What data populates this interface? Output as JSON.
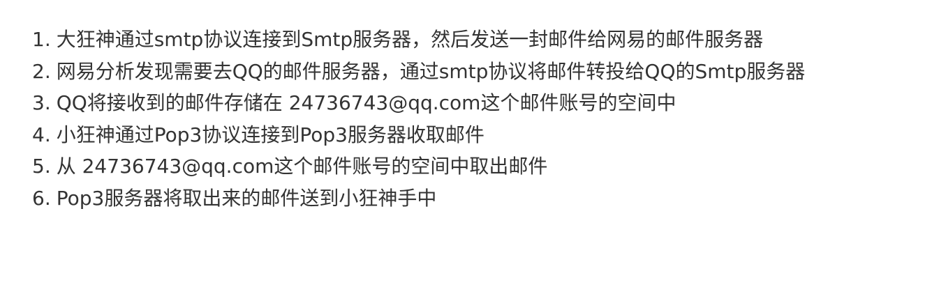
{
  "steps": [
    {
      "num": "1.",
      "text": "大狂神通过smtp协议连接到Smtp服务器，然后发送一封邮件给网易的邮件服务器"
    },
    {
      "num": "2.",
      "text": "网易分析发现需要去QQ的邮件服务器，通过smtp协议将邮件转投给QQ的Smtp服务器"
    },
    {
      "num": "3.",
      "text": "QQ将接收到的邮件存储在 24736743@qq.com这个邮件账号的空间中"
    },
    {
      "num": "4.",
      "text": "小狂神通过Pop3协议连接到Pop3服务器收取邮件"
    },
    {
      "num": "5.",
      "text": "从 24736743@qq.com这个邮件账号的空间中取出邮件"
    },
    {
      "num": "6.",
      "text": "Pop3服务器将取出来的邮件送到小狂神手中"
    }
  ]
}
